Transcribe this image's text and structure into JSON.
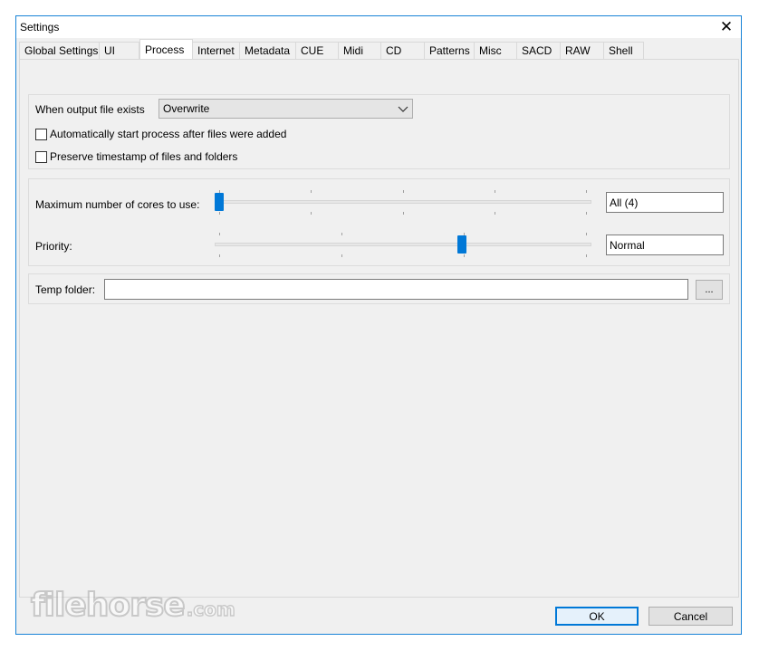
{
  "window": {
    "title": "Settings",
    "close_glyph": "✕"
  },
  "tabs": [
    {
      "label": "Global Settings",
      "active": false
    },
    {
      "label": "UI",
      "active": false
    },
    {
      "label": "Process",
      "active": true
    },
    {
      "label": "Internet",
      "active": false
    },
    {
      "label": "Metadata",
      "active": false
    },
    {
      "label": "CUE",
      "active": false
    },
    {
      "label": "Midi",
      "active": false
    },
    {
      "label": "CD",
      "active": false
    },
    {
      "label": "Patterns",
      "active": false
    },
    {
      "label": "Misc",
      "active": false
    },
    {
      "label": "SACD",
      "active": false
    },
    {
      "label": "RAW",
      "active": false
    },
    {
      "label": "Shell",
      "active": false
    }
  ],
  "output": {
    "label": "When output file exists",
    "selected": "Overwrite",
    "auto_start_label": "Automatically start process after files were added",
    "auto_start_checked": false,
    "preserve_label": "Preserve timestamp of files and folders",
    "preserve_checked": false
  },
  "cores": {
    "label": "Maximum number of cores to use:",
    "value": "All (4)",
    "slider_fraction": 0.0
  },
  "priority": {
    "label": "Priority:",
    "value": "Normal",
    "slider_fraction": 0.66
  },
  "temp": {
    "label": "Temp folder:",
    "value": "",
    "browse_label": "..."
  },
  "buttons": {
    "ok": "OK",
    "cancel": "Cancel"
  },
  "watermark": {
    "brand": "filehorse",
    "suffix": ".com"
  },
  "colors": {
    "accent": "#0078d7",
    "window_border": "#1883d7",
    "face": "#f0f0f0"
  }
}
